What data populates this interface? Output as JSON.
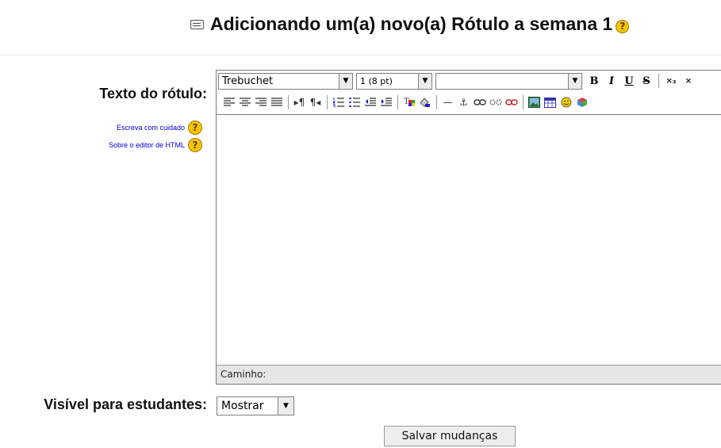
{
  "page": {
    "title": "Adicionando um(a) novo(a) Rótulo a semana 1",
    "help_icon": "?"
  },
  "form": {
    "label_text_field": "Texto do rótulo:",
    "help_links": [
      {
        "text": "Escreva com cuidado",
        "icon": "help-icon"
      },
      {
        "text": "Sobre o editor de HTML",
        "icon": "help-icon"
      }
    ],
    "visible_label": "Visível para estudantes:",
    "visible_value": "Mostrar",
    "save_label": "Salvar mudanças"
  },
  "editor": {
    "font_value": "Trebuchet",
    "size_value": "1 (8 pt)",
    "format_value": "",
    "bold": "B",
    "italic": "I",
    "underline": "U",
    "strike": "S",
    "subscript": "×₂",
    "superscript": "×",
    "path_label": "Caminho:",
    "content": ""
  },
  "colors": {
    "help_badge": "#f6c400",
    "link": "#0000cc",
    "statusbar": "#e6e6e6",
    "button": "#eeeeee"
  }
}
